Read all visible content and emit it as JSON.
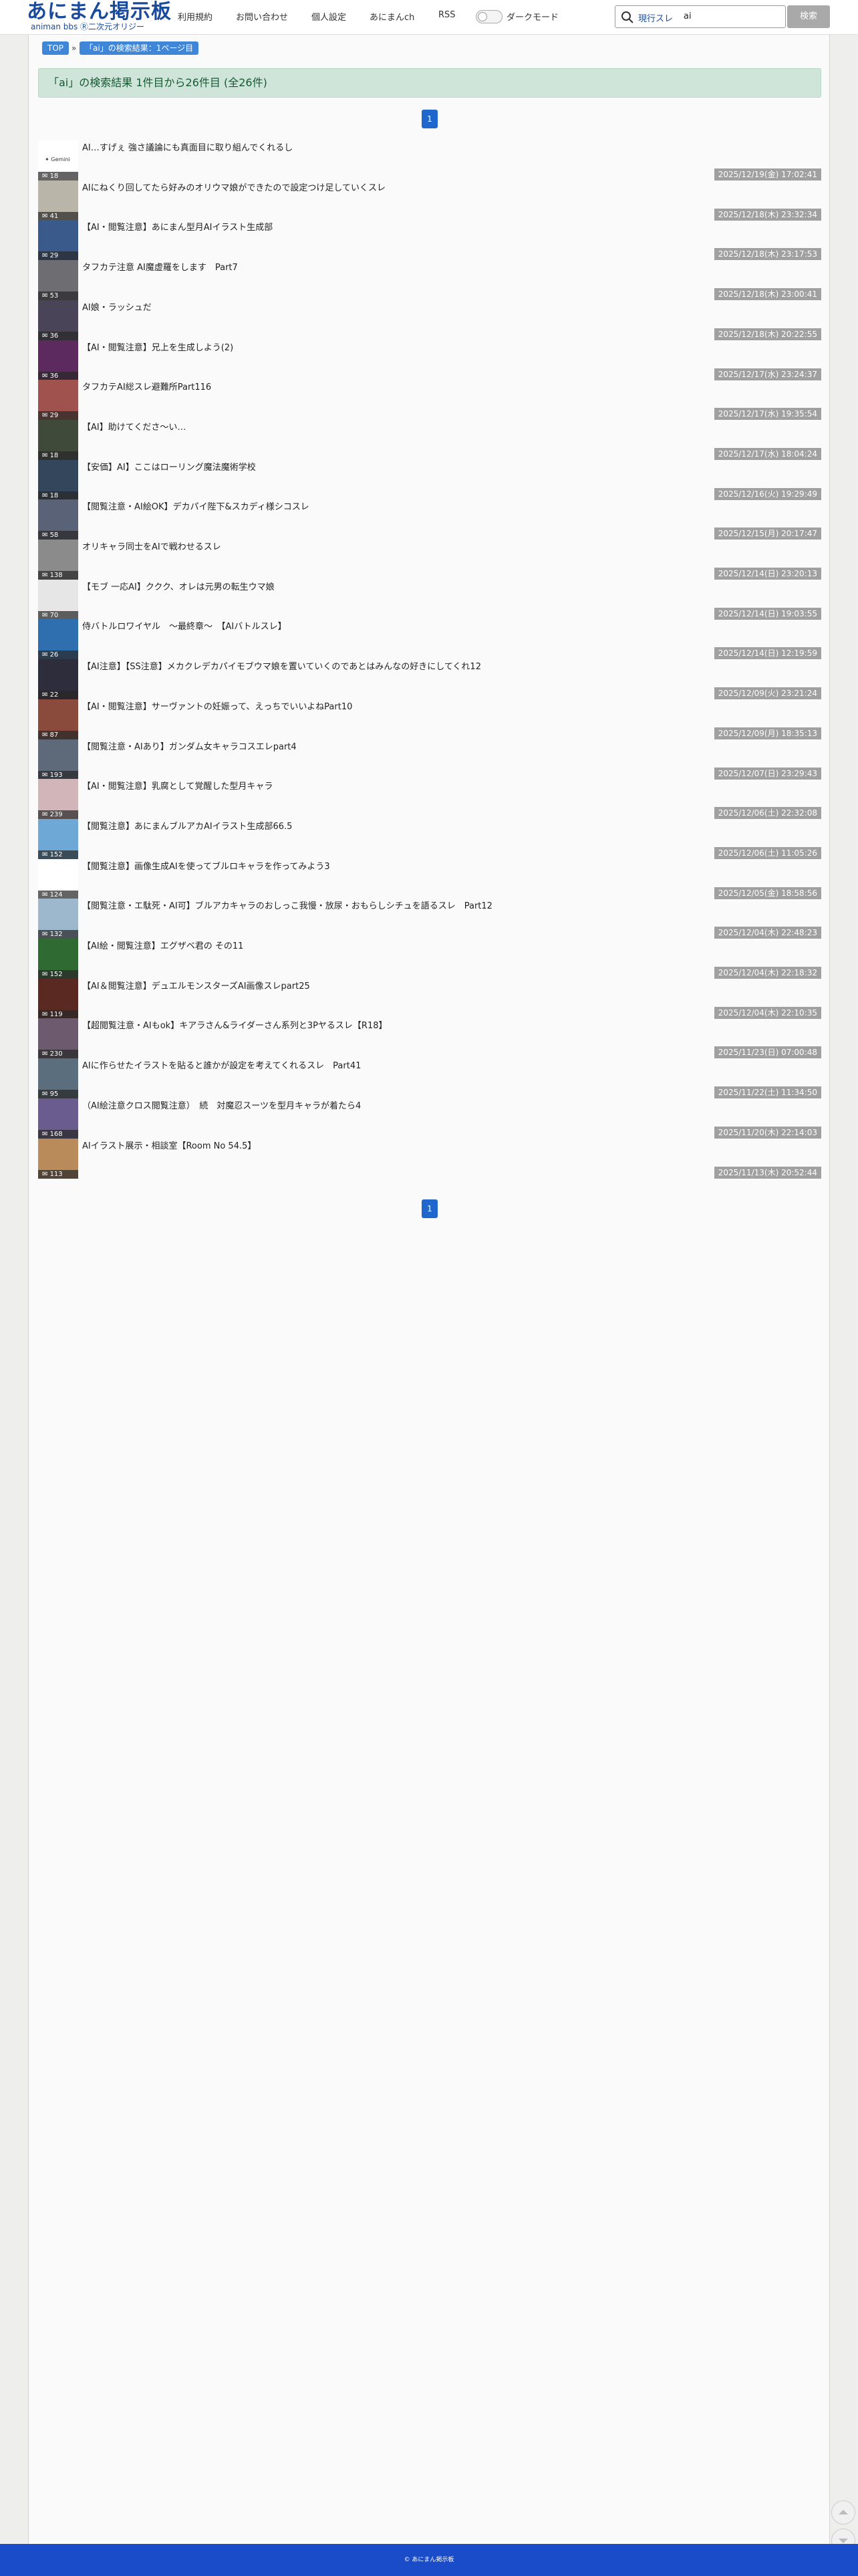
{
  "header": {
    "logo_main": "あにまん掲示板",
    "logo_sub": "animan bbs Ⓡ二次元オリジー",
    "nav": [
      "利用規約",
      "お問い合わせ",
      "個人設定",
      "あにまんch",
      "RSS"
    ],
    "dark_mode_label": "ダークモード",
    "search_scope": "現行スレ",
    "search_query": "ai",
    "search_button": "検索"
  },
  "breadcrumb": {
    "top": "TOP",
    "separator": "»",
    "current": "「ai」の検索結果：1ページ目"
  },
  "result_banner": "「ai」の検索結果 1件目から26件目 (全26件)",
  "pager": {
    "top_page": "1",
    "bottom_page": "1"
  },
  "gemini_badge": "✦ Gemini",
  "threads": [
    {
      "title": "AI…すげぇ 強さ議論にも真面目に取り組んでくれるし",
      "count": "18",
      "date": "2025/12/19(金) 17:02:41",
      "thumb_color": "#ffffff"
    },
    {
      "title": "AIにねくり回してたら好みのオリウマ娘ができたので設定つけ足していくスレ",
      "count": "41",
      "date": "2025/12/18(木) 23:32:34",
      "thumb_color": "#b9b6a9"
    },
    {
      "title": "【AI・閲覧注意】あにまん型月AIイラスト生成部",
      "count": "29",
      "date": "2025/12/18(木) 23:17:53",
      "thumb_color": "#3b5a8c"
    },
    {
      "title": "タフカテ注意 AI魔虚羅をします　Part7",
      "count": "53",
      "date": "2025/12/18(木) 23:00:41",
      "thumb_color": "#6e6e72"
    },
    {
      "title": "AI娘・ラッシュだ",
      "count": "36",
      "date": "2025/12/18(木) 20:22:55",
      "thumb_color": "#4a4458"
    },
    {
      "title": "【AI・閲覧注意】兄上を生成しよう(2)",
      "count": "36",
      "date": "2025/12/17(水) 23:24:37",
      "thumb_color": "#5c2a5e"
    },
    {
      "title": "タフカテAI総スレ避難所Part116",
      "count": "29",
      "date": "2025/12/17(水) 19:35:54",
      "thumb_color": "#a0524e"
    },
    {
      "title": "【AI】助けてくださ〜い…",
      "count": "18",
      "date": "2025/12/17(水) 18:04:24",
      "thumb_color": "#3f4a3a"
    },
    {
      "title": "【安価】AI】ここはローリング魔法魔術学校",
      "count": "18",
      "date": "2025/12/16(火) 19:29:49",
      "thumb_color": "#33465c"
    },
    {
      "title": "【閲覧注意・AI絵OK】デカパイ陛下&スカディ様シコスレ",
      "count": "58",
      "date": "2025/12/15(月) 20:17:47",
      "thumb_color": "#5a6278"
    },
    {
      "title": "オリキャラ同士をAIで戦わせるスレ",
      "count": "138",
      "date": "2025/12/14(日) 23:20:13",
      "thumb_color": "#8b8b8b"
    },
    {
      "title": "【モブ 一応AI】ククク、オレは元男の転生ウマ娘",
      "count": "70",
      "date": "2025/12/14(日) 19:03:55",
      "thumb_color": "#e6e6e6"
    },
    {
      "title": "侍バトルロワイヤル　〜最終章〜　【AIバトルスレ】",
      "count": "26",
      "date": "2025/12/14(日) 12:19:59",
      "thumb_color": "#2f6fb0"
    },
    {
      "title": "【AI注意】【SS注意】メカクレデカパイモブウマ娘を置いていくのであとはみんなの好きにしてくれ12",
      "count": "22",
      "date": "2025/12/09(火) 23:21:24",
      "thumb_color": "#2d2d3b"
    },
    {
      "title": "【AI・閲覧注意】サーヴァントの妊娠って、えっちでいいよねPart10",
      "count": "87",
      "date": "2025/12/09(月) 18:35:13",
      "thumb_color": "#8a4a3c"
    },
    {
      "title": "【閲覧注意・AIあり】ガンダム女キャラコスエレpart4",
      "count": "193",
      "date": "2025/12/07(日) 23:29:43",
      "thumb_color": "#5e6a7a"
    },
    {
      "title": "【AI・閲覧注意】乳腐として覚醒した型月キャラ",
      "count": "239",
      "date": "2025/12/06(土) 22:32:08",
      "thumb_color": "#d2b5b8"
    },
    {
      "title": "【閲覧注意】あにまんブルアカAIイラスト生成部66.5",
      "count": "152",
      "date": "2025/12/06(土) 11:05:26",
      "thumb_color": "#6da8d6"
    },
    {
      "title": "【閲覧注意】画像生成AIを使ってブルロキャラを作ってみよう3",
      "count": "124",
      "date": "2025/12/05(金) 18:58:56",
      "thumb_color": "#ffffff"
    },
    {
      "title": "【閲覧注意・エ駄死・AI可】ブルアカキャラのおしっこ我慢・放尿・おもらしシチュを語るスレ　Part12",
      "count": "132",
      "date": "2025/12/04(木) 22:48:23",
      "thumb_color": "#9db8cc"
    },
    {
      "title": "【AI絵・閲覧注意】エグザベ君の その11",
      "count": "152",
      "date": "2025/12/04(木) 22:18:32",
      "thumb_color": "#2f6a32"
    },
    {
      "title": "【AI＆閲覧注意】デュエルモンスターズAI画像スレpart25",
      "count": "119",
      "date": "2025/12/04(木) 22:10:35",
      "thumb_color": "#5a2a22"
    },
    {
      "title": "【超閲覧注意・AIもok】キアラさん&ライダーさん系列と3Pヤるスレ【R18】",
      "count": "230",
      "date": "2025/11/23(日) 07:00:48",
      "thumb_color": "#6e5a6e"
    },
    {
      "title": "AIに作らせたイラストを貼ると誰かが設定を考えてくれるスレ　Part41",
      "count": "95",
      "date": "2025/11/22(土) 11:34:50",
      "thumb_color": "#5b6e7e"
    },
    {
      "title": "（AI絵注意クロス閲覧注意）　続　対魔忍スーツを型月キャラが着たら4",
      "count": "168",
      "date": "2025/11/20(木) 22:14:03",
      "thumb_color": "#6a5c8e"
    },
    {
      "title": "AIイラスト展示・相談室【Room No 54.5】",
      "count": "113",
      "date": "2025/11/13(木) 20:52:44",
      "thumb_color": "#b98a5a"
    }
  ],
  "footer": "© あにまん掲示板"
}
